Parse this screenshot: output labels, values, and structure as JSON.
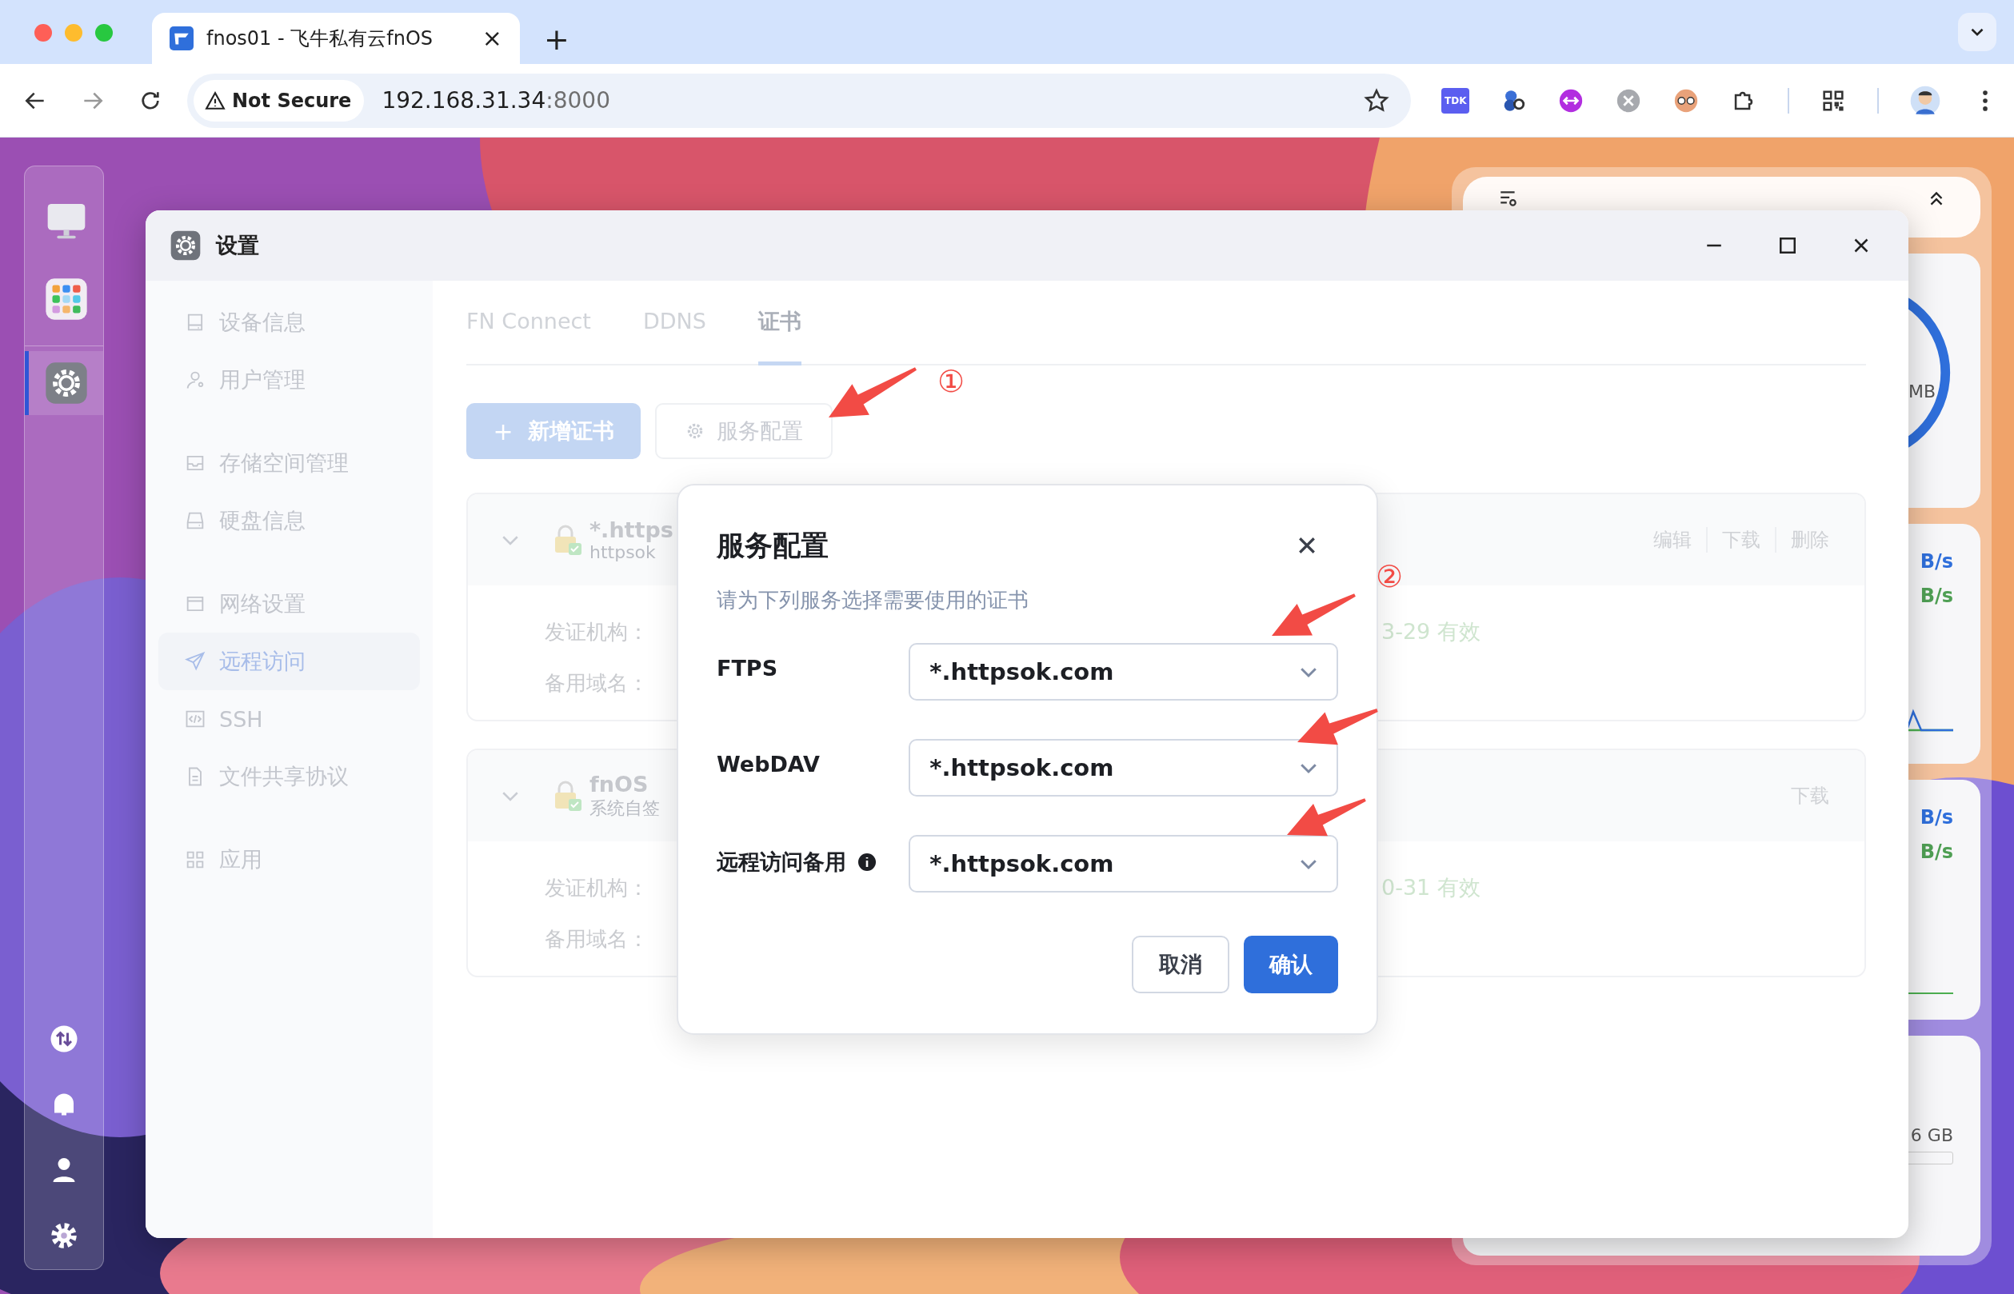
{
  "browser": {
    "tab_title": "fnos01 - 飞牛私有云fnOS",
    "tab_close": "×",
    "new_tab": "+",
    "security_label": "Not Secure",
    "url_host": "192.168.31.34",
    "url_port": ":8000",
    "extension_badge": "TDK"
  },
  "dock": {
    "apps": [
      {
        "selected": false
      },
      {
        "selected": false
      },
      {
        "selected": true
      }
    ]
  },
  "widgets": {
    "memory_unit": "MB",
    "network": [
      {
        "upload": "B/s",
        "download": "B/s"
      },
      {
        "upload": "B/s",
        "download": "B/s"
      }
    ],
    "storage_total": "6 GB"
  },
  "window": {
    "title": "设置",
    "sidebar": {
      "groups": [
        [
          {
            "label": "设备信息",
            "selected": false
          },
          {
            "label": "用户管理",
            "selected": false
          }
        ],
        [
          {
            "label": "存储空间管理",
            "selected": false
          },
          {
            "label": "硬盘信息",
            "selected": false
          }
        ],
        [
          {
            "label": "网络设置",
            "selected": false
          },
          {
            "label": "远程访问",
            "selected": true
          },
          {
            "label": "SSH",
            "selected": false
          },
          {
            "label": "文件共享协议",
            "selected": false
          }
        ],
        [
          {
            "label": "应用",
            "selected": false
          }
        ]
      ]
    },
    "tabs": [
      {
        "label": "FN Connect",
        "selected": false
      },
      {
        "label": "DDNS",
        "selected": false
      },
      {
        "label": "证书",
        "selected": true
      }
    ],
    "add_button": {
      "icon": "+",
      "label": "新增证书"
    },
    "service_button": {
      "label": "服务配置"
    },
    "certificates": [
      {
        "title": "*.https",
        "subtitle": "httpsok",
        "actions": [
          "编辑",
          "下载",
          "删除"
        ],
        "fields": [
          {
            "label": "发证机构：",
            "validity": "3-29 有效"
          },
          {
            "label": "备用域名："
          }
        ]
      },
      {
        "title": "fnOS",
        "subtitle": "系统自签",
        "actions": [
          "下载"
        ],
        "fields": [
          {
            "label": "发证机构：",
            "validity": "0-31 有效"
          },
          {
            "label": "备用域名："
          }
        ]
      }
    ]
  },
  "dialog": {
    "title": "服务配置",
    "subtitle": "请为下列服务选择需要使用的证书",
    "rows": [
      {
        "label": "FTPS",
        "value": "*.httpsok.com",
        "info": false
      },
      {
        "label": "WebDAV",
        "value": "*.httpsok.com",
        "info": false
      },
      {
        "label": "远程访问备用",
        "value": "*.httpsok.com",
        "info": true
      }
    ],
    "buttons": [
      {
        "label": "取消",
        "kind": "secondary"
      },
      {
        "label": "确认",
        "kind": "primary"
      }
    ]
  },
  "annotations": [
    {
      "number": "①"
    },
    {
      "number": "②"
    }
  ]
}
